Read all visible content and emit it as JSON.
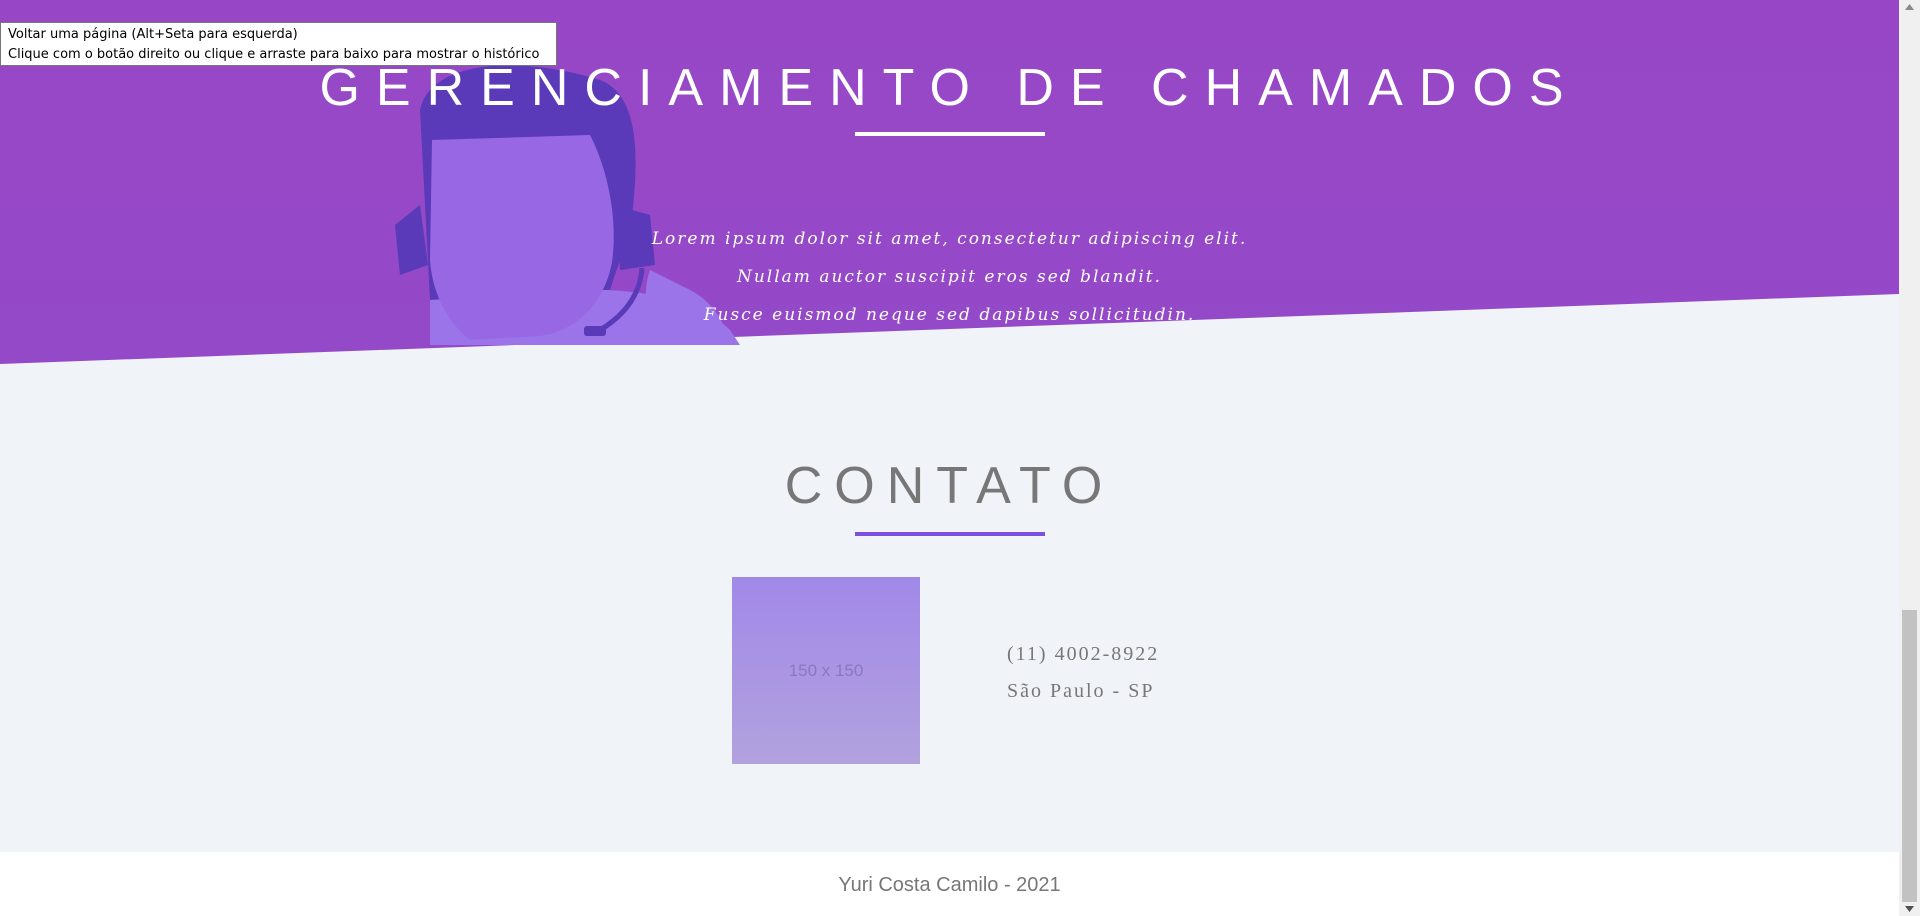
{
  "browser": {
    "back_tooltip": {
      "line1": "Voltar uma página (Alt+Seta para esquerda)",
      "line2": "Clique com o botão direito ou clique e arraste para baixo para mostrar o histórico"
    }
  },
  "hero": {
    "title": "GERENCIAMENTO DE CHAMADOS",
    "lines": [
      "Lorem ipsum dolor sit amet, consectetur adipiscing elit.",
      "Nullam auctor suscipit eros sed blandit.",
      "Fusce euismod neque sed dapibus sollicitudin."
    ],
    "illustration": "headset-agent-illustration"
  },
  "contact": {
    "title": "CONTATO",
    "image_placeholder": "150 x 150",
    "phone": "(11) 4002-8922",
    "location": "São Paulo - SP"
  },
  "footer": {
    "text": "Yuri Costa Camilo - 2021"
  },
  "colors": {
    "hero_purple": "#9747c6",
    "accent": "#7b4fe0",
    "section_bg": "#f0f3f7",
    "text_gray": "#777777"
  }
}
